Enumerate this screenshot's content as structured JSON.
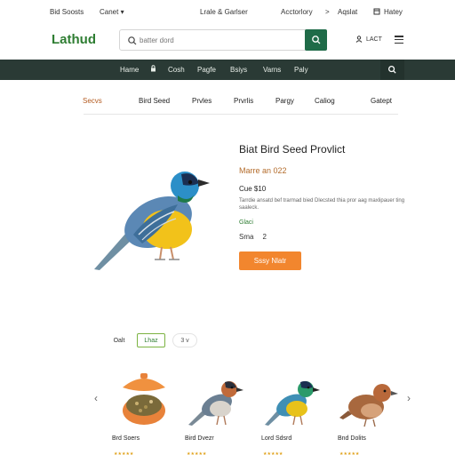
{
  "topbar": {
    "left1": "Bid Soosts",
    "left2": "Canet",
    "left2_caret": "▾",
    "middle": "Lrale & Garlser",
    "right1": "Acctorlory",
    "right2": ">",
    "right3": "Aqslat",
    "right5": "Hatey"
  },
  "header": {
    "logo": "Lathud",
    "search_placeholder": "batter dord",
    "account_label": "LACT"
  },
  "nav": {
    "items": [
      "Hame",
      "Cosh",
      "Pagfe",
      "Bsiys",
      "Varns",
      "Paly"
    ]
  },
  "categories": {
    "items": [
      "Secvs",
      "Bird Seed",
      "Prvles",
      "Prvrlis",
      "Pargy",
      "Caliog",
      "Gatept"
    ]
  },
  "product": {
    "title": "Biat Bird Seed Provlict",
    "price": "Marre an 022",
    "stock": "Cue $10",
    "description": "Tarrdie ansatd bef trarmad bied Dlecsted thia pror aag maxlipauer ting saaleck.",
    "option": "Glaci",
    "size_label": "Sma",
    "size_value": "2",
    "cta": "Sssy Nlatr"
  },
  "filters": {
    "items": [
      "Oalt",
      "Lhaz",
      "3 v"
    ]
  },
  "carousel": {
    "prev": "‹",
    "next": "›",
    "cards": [
      {
        "name": "Brd Soers",
        "stars": "★★★★★"
      },
      {
        "name": "Bird Dvezr",
        "stars": "★★★★★"
      },
      {
        "name": "Lord Sdsrd",
        "stars": "★★★★★"
      },
      {
        "name": "Bnd Dolits",
        "stars": "★★★★★"
      }
    ]
  },
  "colors": {
    "brand_green": "#2e7d32",
    "nav_bg": "#2a3a35",
    "cta_orange": "#f2862e",
    "active_category": "#b35a1f"
  }
}
